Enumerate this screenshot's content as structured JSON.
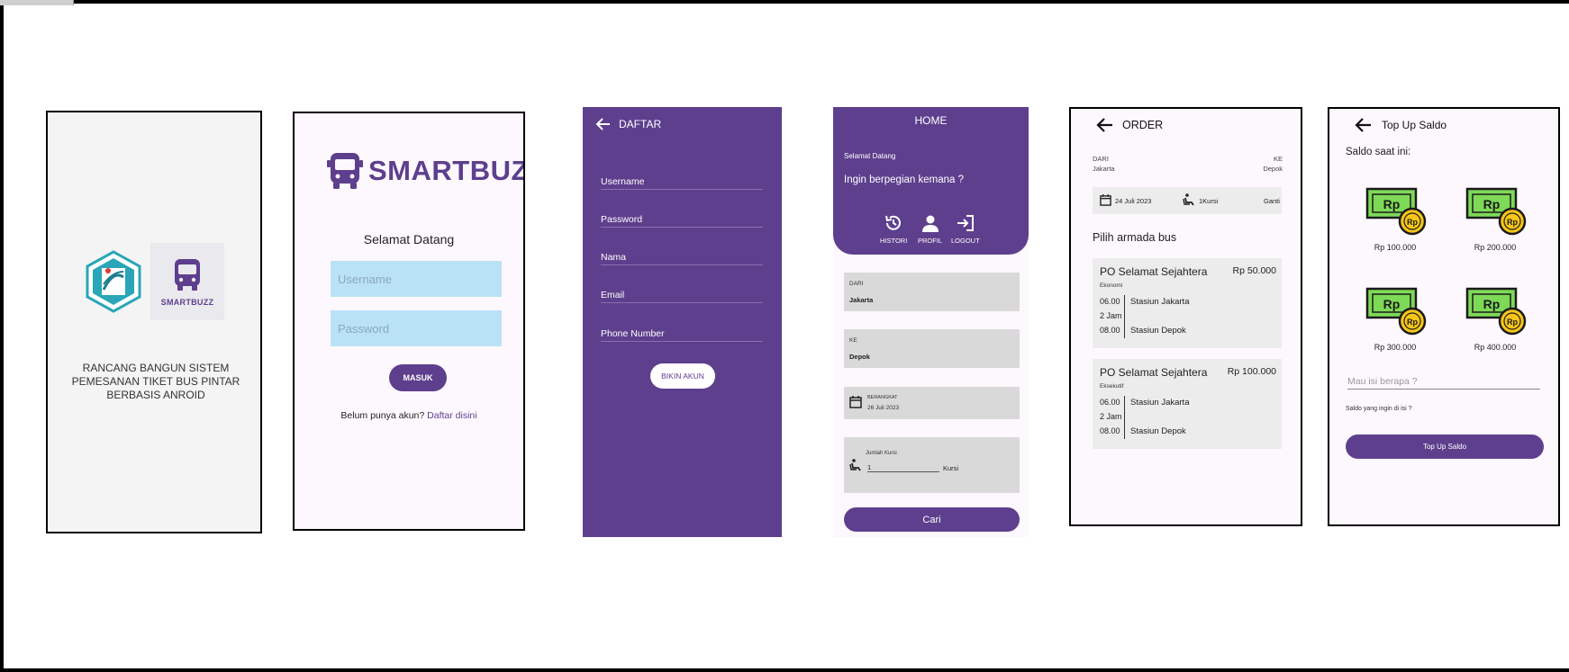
{
  "splash": {
    "logo_text": "SMARTBUZZ",
    "app_title": "RANCANG BANGUN SISTEM PEMESANAN TIKET BUS PINTAR BERBASIS ANROID"
  },
  "login": {
    "brand": "SMARTBUZZ",
    "welcome": "Selamat Datang",
    "username_placeholder": "Username",
    "password_placeholder": "Password",
    "login_button": "MASUK",
    "register_prompt": "Belum punya akun? ",
    "register_link": "Daftar disini"
  },
  "register": {
    "title": "DAFTAR",
    "fields": [
      "Username",
      "Password",
      "Nama",
      "Email",
      "Phone Number"
    ],
    "submit_button": "BIKIN AKUN"
  },
  "home": {
    "title": "HOME",
    "greeting": "Selamat Datang",
    "question": "Ingin berpegian kemana ?",
    "nav": [
      "HISTORI",
      "PROFIL",
      "LOGOUT"
    ],
    "from_label": "DARI",
    "from_value": "Jakarta",
    "to_label": "KE",
    "to_value": "Depok",
    "depart_label": "BERANGKAT",
    "depart_value": "26 Juli 2023",
    "seat_label": "Jumlah Kursi",
    "seat_value": "1",
    "seat_unit": "Kursi",
    "search_button": "Cari"
  },
  "order": {
    "title": "ORDER",
    "from_label": "DARI",
    "from_value": "Jakarta",
    "to_label": "KE",
    "to_value": "Depok",
    "date": "24 Juli 2023",
    "seats": "1Kursi",
    "change": "Ganti",
    "choose": "Pilih armada bus",
    "buses": [
      {
        "name": "PO Selamat Sejahtera",
        "price": "Rp 50.000",
        "class": "Ekonomi",
        "depart_time": "06.00",
        "duration": "2 Jam",
        "arrive_time": "08.00",
        "from_station": "Stasiun Jakarta",
        "to_station": "Stasiun Depok"
      },
      {
        "name": "PO Selamat Sejahtera",
        "price": "Rp 100.000",
        "class": "Eksekutif",
        "depart_time": "06.00",
        "duration": "2 Jam",
        "arrive_time": "08.00",
        "from_station": "Stasiun Jakarta",
        "to_station": "Stasiun Depok"
      }
    ]
  },
  "topup": {
    "title": "Top Up Saldo",
    "balance_label": "Saldo saat ini:",
    "options": [
      "Rp 100.000",
      "Rp 200.000",
      "Rp 300.000",
      "Rp 400.000"
    ],
    "money_symbol": "Rp",
    "amount_placeholder": "Mau isi berapa ?",
    "hint": "Saldo yang ingin di isi ?",
    "submit_button": "Top Up Saldo"
  },
  "colors": {
    "primary": "#5e3f8d",
    "input_blue": "#b9e2f7",
    "card_gray": "#d9d9d9",
    "money_green": "#7ed957",
    "coin_gold": "#f5c518"
  }
}
